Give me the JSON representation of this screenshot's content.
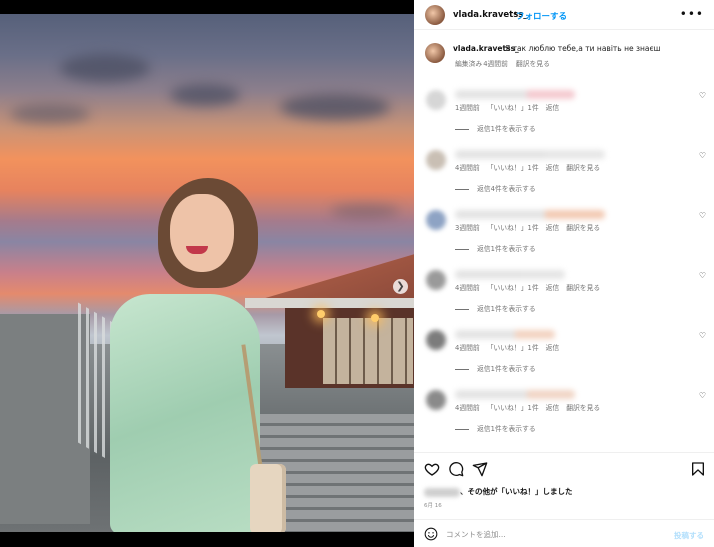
{
  "post": {
    "username": "vlada.kravetss_",
    "follow_label": "フォローする",
    "separator": "•",
    "more": "•••"
  },
  "caption": {
    "username": "vlada.kravetss_",
    "text": "Я так люблю тебе,а ти навіть не знаєш",
    "edited": "編集済み",
    "time": "4週間前",
    "translate": "翻訳を見る"
  },
  "comments": [
    {
      "time": "1週間前",
      "likes": "「いいね！」1件",
      "reply": "返信",
      "translate": "",
      "replies": "返信1件を表示する",
      "avatar_color": "#d6d6d6",
      "name_color": "#f4c9cf"
    },
    {
      "time": "4週間前",
      "likes": "「いいね！」1件",
      "reply": "返信",
      "translate": "翻訳を見る",
      "replies": "返信4件を表示する",
      "avatar_color": "#c9bfb4",
      "name_color": "#e6e6e6"
    },
    {
      "time": "3週間前",
      "likes": "「いいね！」1件",
      "reply": "返信",
      "translate": "翻訳を見る",
      "replies": "返信1件を表示する",
      "avatar_color": "#8ea3c4",
      "name_color": "#f2c9b2"
    },
    {
      "time": "4週間前",
      "likes": "「いいね！」1件",
      "reply": "返信",
      "translate": "翻訳を見る",
      "replies": "返信1件を表示する",
      "avatar_color": "#9a9a9a",
      "name_color": "#e4e4e4"
    },
    {
      "time": "4週間前",
      "likes": "「いいね！」1件",
      "reply": "返信",
      "translate": "",
      "replies": "返信1件を表示する",
      "avatar_color": "#7c7c7c",
      "name_color": "#f2d2c0"
    },
    {
      "time": "4週間前",
      "likes": "「いいね！」1件",
      "reply": "返信",
      "translate": "翻訳を見る",
      "replies": "返信1件を表示する",
      "avatar_color": "#8a8a8a",
      "name_color": "#f0d4c4"
    }
  ],
  "likes_text": "、その他が「いいね！」しました",
  "date": "6月 16",
  "add_comment": {
    "placeholder": "コメントを追加...",
    "post_label": "投稿する"
  },
  "icons": {
    "heart": "heart-icon",
    "comment": "comment-icon",
    "share": "share-icon",
    "save": "bookmark-icon",
    "emoji": "emoji-icon",
    "next": "chevron-right-icon"
  },
  "colors": {
    "accent": "#0095f6",
    "post_disabled": "#b2dffc"
  },
  "carousel": {
    "total": 5,
    "active": 1
  }
}
